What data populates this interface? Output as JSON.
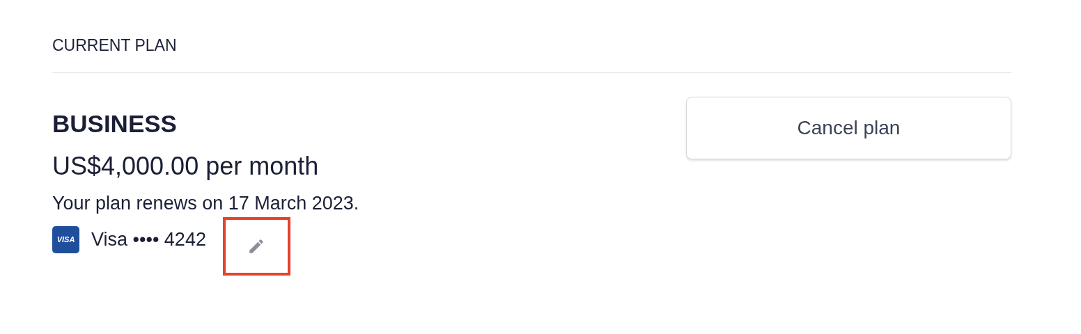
{
  "section_title": "CURRENT PLAN",
  "plan": {
    "name": "BUSINESS",
    "price": "US$4,000.00 per month",
    "renewal": "Your plan renews on 17 March 2023."
  },
  "payment_method": {
    "logo_text": "VISA",
    "brand": "Visa",
    "masked_number": "•••• 4242",
    "edit_highlighted": true
  },
  "buttons": [
    {
      "label": "Cancel plan"
    }
  ]
}
